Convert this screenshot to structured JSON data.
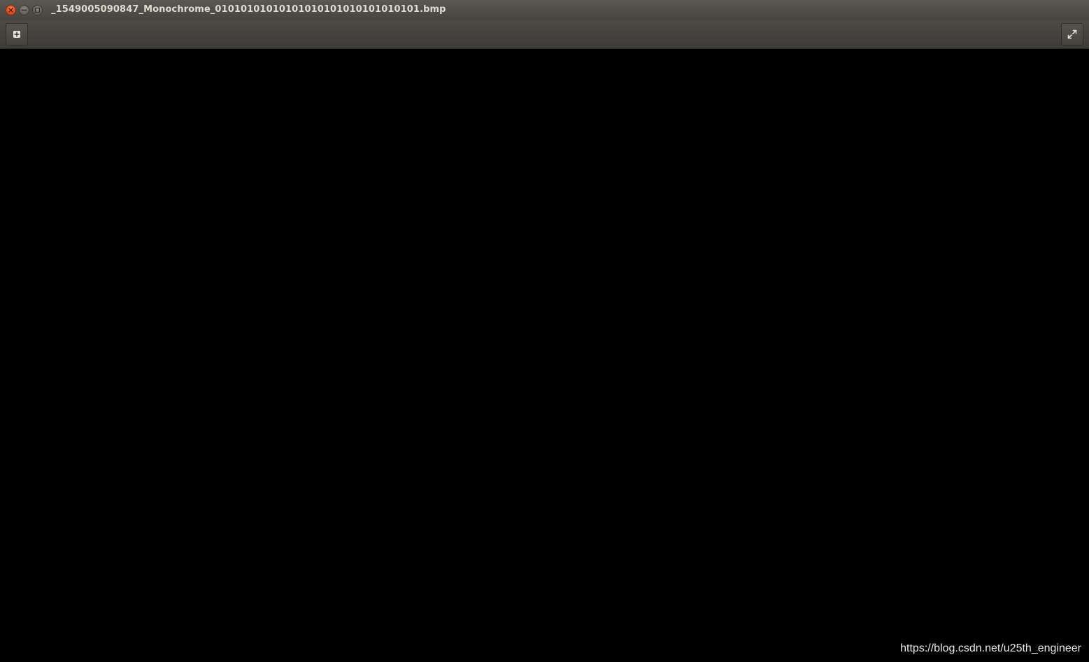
{
  "window": {
    "title": "_1549005090847_Monochrome_01010101010101010101010101010101.bmp"
  },
  "controls": {
    "close_icon": "close-icon",
    "minimize_icon": "minimize-icon",
    "maximize_icon": "maximize-icon"
  },
  "toolbar": {
    "left_button_icon": "add-icon",
    "right_button_icon": "fullscreen-icon"
  },
  "viewer": {
    "background_color": "#000000"
  },
  "watermark": {
    "text": "https://blog.csdn.net/u25th_engineer"
  }
}
